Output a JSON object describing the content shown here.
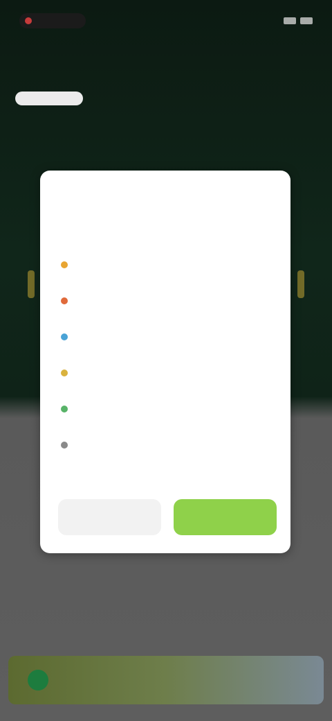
{
  "status": {
    "time": "",
    "right_text": ""
  },
  "background": {
    "subtitle": "",
    "tabs": [
      {
        "label": ""
      },
      {
        "label": ""
      },
      {
        "label": ""
      },
      {
        "label": ""
      }
    ]
  },
  "modal": {
    "title": "",
    "action_label": "",
    "options": [
      {
        "label": "",
        "value": "",
        "color": "#e8a532"
      },
      {
        "label": "",
        "value": "",
        "color": "#e06a3b"
      },
      {
        "label": "",
        "value": "",
        "color": "#4aa3d6"
      },
      {
        "label": "",
        "value": "",
        "color": "#d9b23e"
      },
      {
        "label": "",
        "value": "",
        "color": "#58b368"
      },
      {
        "label": "",
        "value": "",
        "color": "#8a8a8a"
      }
    ],
    "note": "",
    "cancel_label": "",
    "confirm_label": ""
  },
  "banner": {
    "text": ""
  },
  "colors": {
    "accent": "#8fd14a",
    "background_dark": "#0f1d15",
    "overlay_gray": "#5e5e5e"
  }
}
